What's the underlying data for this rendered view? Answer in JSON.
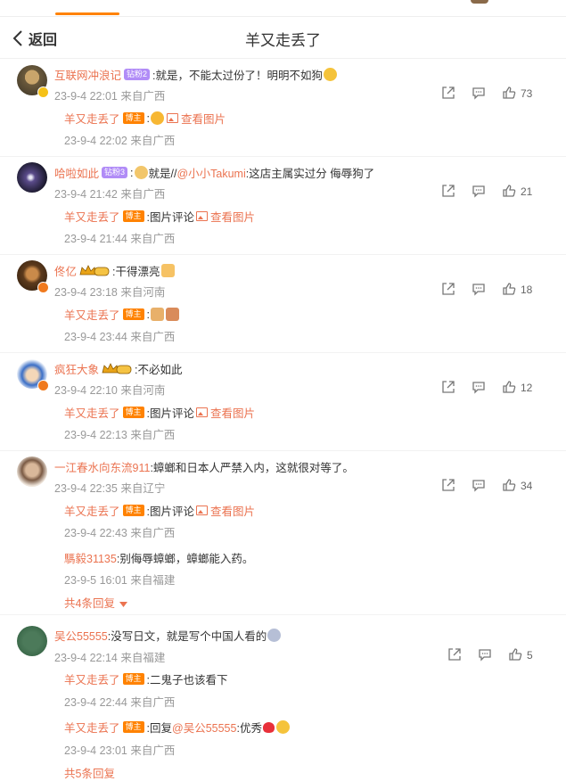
{
  "header": {
    "back_label": "返回",
    "title": "羊又走丢了"
  },
  "comments": [
    {
      "user": "互联网冲浪记",
      "badge": "钻粉2",
      "text": ":就是，不能太过份了！明明不如狗",
      "meta": "23-9-4 22:01 来自广西",
      "likes": "73",
      "reply": {
        "user": "羊又走丢了",
        "badge": "博主",
        "text": ":",
        "link": "查看图片",
        "meta": "23-9-4 22:02 来自广西"
      }
    },
    {
      "user": "哈啦如此",
      "badge": "钻粉3",
      "text_a": ":",
      "text_b": "就是//",
      "mention": "@小小Takumi",
      "text_c": ":这店主属实过分 侮辱狗了",
      "meta": "23-9-4 21:42 来自广西",
      "likes": "21",
      "reply": {
        "user": "羊又走丢了",
        "badge": "博主",
        "text": ":图片评论",
        "link": "查看图片",
        "meta": "23-9-4 21:44 来自广西"
      }
    },
    {
      "user": "佟亿",
      "crown_level": "1",
      "text": ":干得漂亮",
      "meta": "23-9-4 23:18 来自河南",
      "likes": "18",
      "reply": {
        "user": "羊又走丢了",
        "badge": "博主",
        "text": ":",
        "meta": "23-9-4 23:44 来自广西"
      }
    },
    {
      "user": "疯狂大象",
      "crown_level": "1",
      "text": ":不必如此",
      "meta": "23-9-4 22:10 来自河南",
      "likes": "12",
      "reply": {
        "user": "羊又走丢了",
        "badge": "博主",
        "text": ":图片评论",
        "link": "查看图片",
        "meta": "23-9-4 22:13 来自广西"
      }
    },
    {
      "user": "一江春水向东流911",
      "text": ":蟑螂和日本人严禁入内，这就很对等了。",
      "meta": "23-9-4 22:35 来自辽宁",
      "likes": "34",
      "reply": {
        "user": "羊又走丢了",
        "badge": "博主",
        "text": ":图片评论",
        "link": "查看图片",
        "meta": "23-9-4 22:43 来自广西"
      },
      "reply2": {
        "user": "騳毅31135",
        "text": ":别侮辱蟑螂，蟑螂能入药。",
        "meta": "23-9-5 16:01 来自福建"
      },
      "more": "共4条回复"
    },
    {
      "user": "吴公55555",
      "text": ":没写日文，就是写个中国人看的",
      "meta": "23-9-4 22:14 来自福建",
      "likes": "5",
      "reply": {
        "user": "羊又走丢了",
        "badge": "博主",
        "text": ":二鬼子也该看下",
        "meta": "23-9-4 22:44 来自广西"
      },
      "reply2": {
        "user": "羊又走丢了",
        "badge": "博主",
        "text_a": ":回复",
        "mention": "@吴公55555",
        "text_b": ":优秀",
        "meta": "23-9-4 23:01 来自广西"
      },
      "more": "共5条回复"
    }
  ],
  "colors": {
    "accent": "#ff8200",
    "username": "#eb7350",
    "meta": "#999999",
    "badge_purple": "#b18cf7"
  },
  "icons": [
    "back-chevron-icon",
    "share-icon",
    "comment-icon",
    "like-icon",
    "image-icon",
    "crown-icon"
  ]
}
